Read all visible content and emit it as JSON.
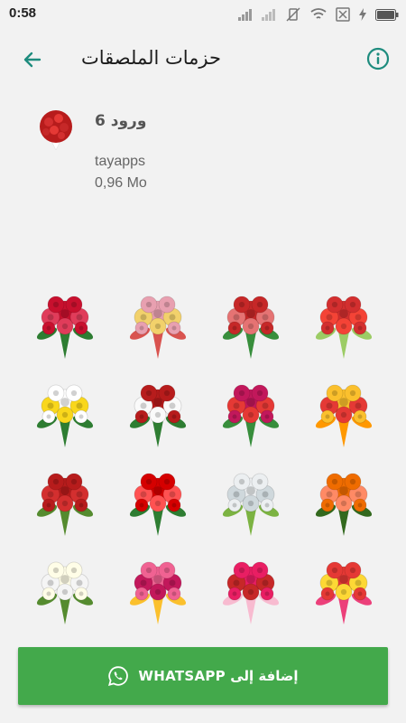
{
  "status_bar": {
    "time": "0:58",
    "signal_a_label": "signal-bars",
    "signal_b_label": "signal-bars-empty"
  },
  "app_bar": {
    "title": "حزمات الملصقات",
    "back_icon": "arrow-left-icon",
    "info_icon": "info-icon"
  },
  "pack": {
    "name": "ورود 6",
    "publisher": "tayapps",
    "size": "0,96 Mo"
  },
  "stickers": [
    {
      "name": "roses-lying-bouquet",
      "palette": [
        "#c8102e",
        "#e03c5a",
        "#2e7d32"
      ]
    },
    {
      "name": "mixed-bouquet-vase",
      "palette": [
        "#e8a0b0",
        "#f2d16b",
        "#d9534f"
      ]
    },
    {
      "name": "red-bouquet-ribbon",
      "palette": [
        "#c62828",
        "#e57373",
        "#388e3c"
      ]
    },
    {
      "name": "red-roses-ribbon",
      "palette": [
        "#d32f2f",
        "#f44336",
        "#9ccc65"
      ]
    },
    {
      "name": "white-daisy",
      "palette": [
        "#ffffff",
        "#f9d71c",
        "#2e7d32"
      ]
    },
    {
      "name": "red-white-round-bouquet",
      "palette": [
        "#b71c1c",
        "#fafafa",
        "#2e7d32"
      ]
    },
    {
      "name": "red-roses-bouquet",
      "palette": [
        "#c2185b",
        "#e53935",
        "#388e3c"
      ]
    },
    {
      "name": "yellow-red-bouquet",
      "palette": [
        "#fbc02d",
        "#e53935",
        "#ff9800"
      ]
    },
    {
      "name": "red-roses-dome",
      "palette": [
        "#b71c1c",
        "#d32f2f",
        "#558b2f"
      ]
    },
    {
      "name": "red-tulips",
      "palette": [
        "#d50000",
        "#ff5252",
        "#2e7d32"
      ]
    },
    {
      "name": "white-tulips",
      "palette": [
        "#eceff1",
        "#cfd8dc",
        "#7cb342"
      ]
    },
    {
      "name": "orange-roses",
      "palette": [
        "#ef6c00",
        "#ff8a65",
        "#33691e"
      ]
    },
    {
      "name": "white-rose-bouquet",
      "palette": [
        "#fffde7",
        "#f5f5f5",
        "#558b2f"
      ]
    },
    {
      "name": "pink-roses",
      "palette": [
        "#f06292",
        "#c2185b",
        "#fbc02d"
      ]
    },
    {
      "name": "pink-red-bouquet",
      "palette": [
        "#e91e63",
        "#c62828",
        "#f8bbd0"
      ]
    },
    {
      "name": "multicolor-rose-dome",
      "palette": [
        "#e53935",
        "#fdd835",
        "#ec407a"
      ]
    }
  ],
  "add_button": {
    "label": "إضافة إلى WHATSAPP",
    "icon": "whatsapp-icon",
    "color": "#43a94b"
  },
  "colors": {
    "accent": "#1e8c7e",
    "background": "#f2f2f2"
  }
}
